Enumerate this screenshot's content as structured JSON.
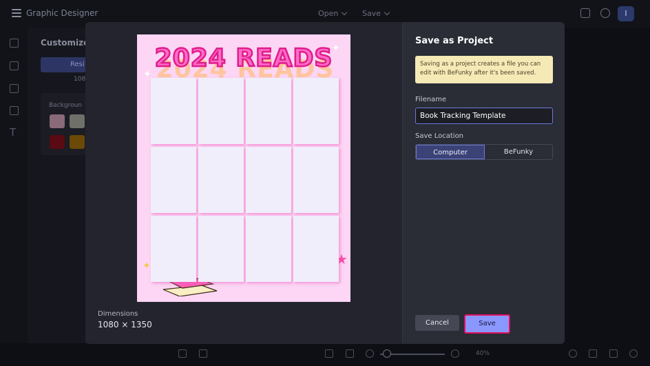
{
  "app": {
    "title": "Graphic Designer",
    "menu_open": "Open",
    "menu_save": "Save",
    "avatar_initial": "I"
  },
  "side_panel": {
    "title": "Customize",
    "tab_label": "Resi",
    "size_hint": "108",
    "background_label": "Backgroun"
  },
  "bottom": {
    "zoom": "40%"
  },
  "modal": {
    "title": "Save as Project",
    "notice": "Saving as a project creates a file you can edit with BeFunky after it's been saved.",
    "filename_label": "Filename",
    "filename_value": "Book Tracking Template",
    "location_label": "Save Location",
    "location_options": [
      "Computer",
      "BeFunky"
    ],
    "location_selected": "Computer",
    "cancel_label": "Cancel",
    "save_label": "Save",
    "dimensions_label": "Dimensions",
    "dimensions_value": "1080 × 1350"
  },
  "poster": {
    "title": "2024 READS",
    "grid_rows": 3,
    "grid_cols": 4
  },
  "colors": {
    "accent": "#8a97ff",
    "highlight": "#e0115f",
    "notice_bg": "#f5e9b6",
    "poster_bg": "#fcd6f4",
    "poster_title": "#ff6cc8"
  }
}
